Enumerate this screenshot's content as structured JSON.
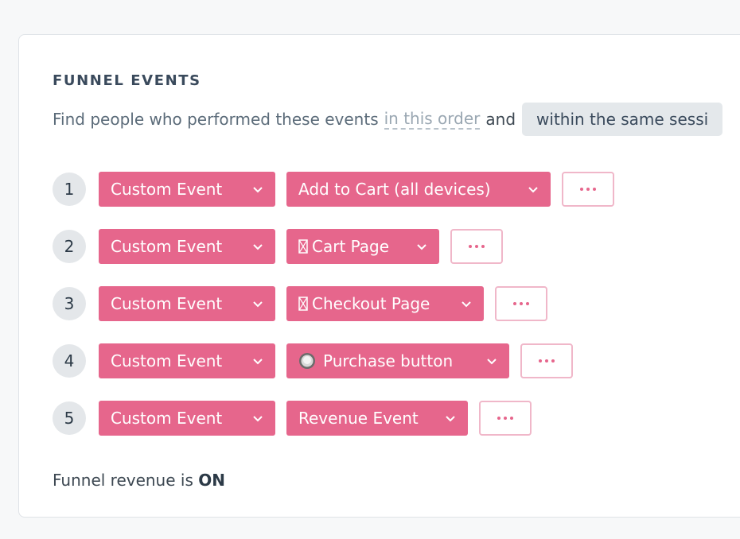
{
  "section_title": "FUNNEL EVENTS",
  "description": {
    "prefix": "Find people who performed these events",
    "order_link": "in this order",
    "conjunction": "and",
    "session_option": "within the same sessi"
  },
  "steps": [
    {
      "number": "1",
      "type_label": "Custom Event",
      "event_label": "Add to Cart (all devices)",
      "event_icon": "none"
    },
    {
      "number": "2",
      "type_label": "Custom Event",
      "event_label": "Cart Page",
      "event_icon": "page-placeholder-icon"
    },
    {
      "number": "3",
      "type_label": "Custom Event",
      "event_label": "Checkout Page",
      "event_icon": "page-placeholder-icon"
    },
    {
      "number": "4",
      "type_label": "Custom Event",
      "event_label": "Purchase button",
      "event_icon": "button-thumbnail-icon"
    },
    {
      "number": "5",
      "type_label": "Custom Event",
      "event_label": "Revenue Event",
      "event_icon": "none"
    }
  ],
  "more_button_icon": "ellipsis-icon",
  "revenue": {
    "prefix": "Funnel revenue is",
    "status": "ON"
  },
  "colors": {
    "accent": "#e6668c",
    "accent_border": "#f0b7c9",
    "step_badge": "#e4e7ea",
    "pill": "#e4e8eb"
  }
}
